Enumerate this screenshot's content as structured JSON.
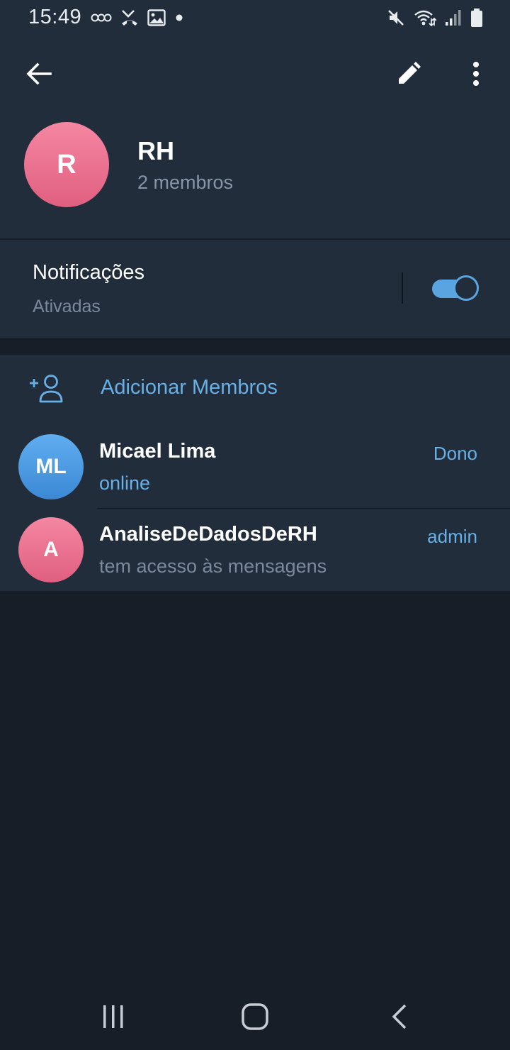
{
  "status_bar": {
    "time": "15:49",
    "left_icons": [
      "voicemail-icon",
      "missed-call-icon",
      "image-icon",
      "dot-icon"
    ],
    "right_icons": [
      "mute-icon",
      "wifi-icon",
      "signal-icon",
      "battery-icon"
    ]
  },
  "toolbar": {
    "back_icon": "arrow-back-icon",
    "edit_icon": "pencil-icon",
    "more_icon": "more-vert-icon"
  },
  "group": {
    "avatar_letter": "R",
    "avatar_color": "#e8698a",
    "title": "RH",
    "subtitle": "2 membros"
  },
  "notifications": {
    "title": "Notificações",
    "status": "Ativadas",
    "enabled": true,
    "accent": "#5aa5e1"
  },
  "members": {
    "add_label": "Adicionar Membros",
    "add_icon": "add-person-icon",
    "list": [
      {
        "initials": "ML",
        "avatar_color": "#4b9ae4",
        "name": "Micael Lima",
        "status": "online",
        "status_color": "#67b0e8",
        "role": "Dono"
      },
      {
        "initials": "A",
        "avatar_color": "#e8698a",
        "name": "AnaliseDeDadosDeRH",
        "status": "tem acesso às mensagens",
        "status_color": "#7a8a9c",
        "role": "admin"
      }
    ]
  },
  "nav_bar": {
    "icons": [
      "recent-apps-icon",
      "home-icon",
      "back-nav-icon"
    ]
  }
}
